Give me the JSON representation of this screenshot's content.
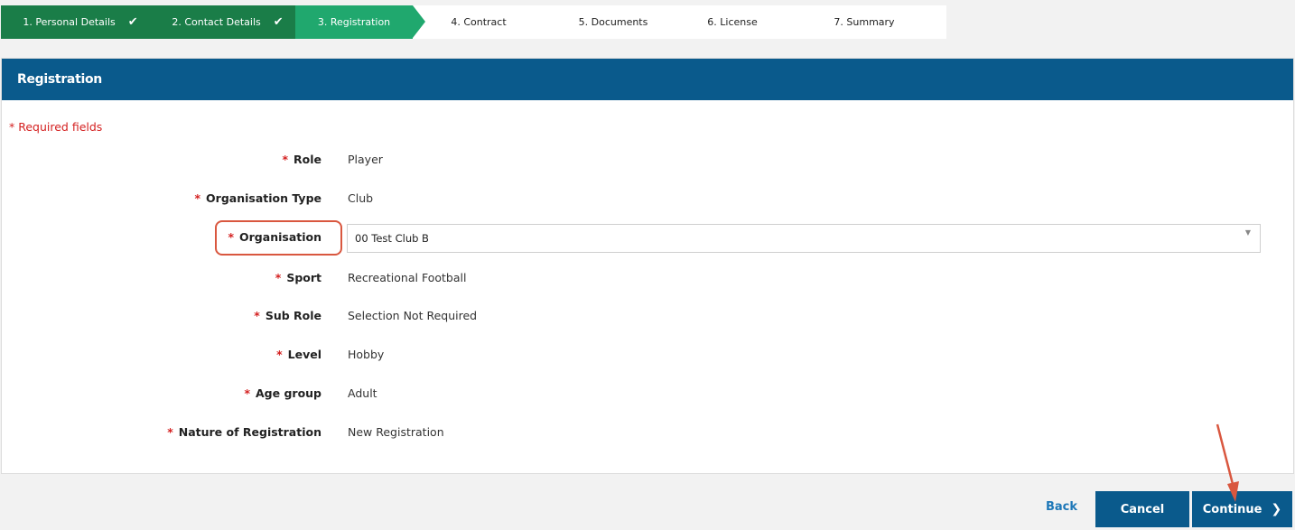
{
  "stepper": {
    "steps": [
      {
        "label": "1. Personal Details",
        "status": "done",
        "check": "✔"
      },
      {
        "label": "2. Contact Details",
        "status": "done",
        "check": "✔"
      },
      {
        "label": "3. Registration",
        "status": "active"
      },
      {
        "label": "4. Contract",
        "status": "pending"
      },
      {
        "label": "5. Documents",
        "status": "pending"
      },
      {
        "label": "6. License",
        "status": "pending"
      },
      {
        "label": "7. Summary",
        "status": "pending"
      }
    ]
  },
  "panel": {
    "title": "Registration",
    "required_note": "* Required fields"
  },
  "form": {
    "fields": [
      {
        "label": "Role",
        "value": "Player"
      },
      {
        "label": "Organisation Type",
        "value": "Club"
      },
      {
        "label": "Organisation",
        "value": "00 Test Club B"
      },
      {
        "label": "Sport",
        "value": "Recreational Football"
      },
      {
        "label": "Sub Role",
        "value": "Selection Not Required"
      },
      {
        "label": "Level",
        "value": "Hobby"
      },
      {
        "label": "Age group",
        "value": "Adult"
      },
      {
        "label": "Nature of Registration",
        "value": "New Registration"
      }
    ],
    "star": "*",
    "select_caret": "▼"
  },
  "footer": {
    "back_label": "Back",
    "cancel_label": "Cancel",
    "continue_label": "Continue",
    "continue_chevron": "❯"
  },
  "colors": {
    "header_blue": "#0a5a8c",
    "step_done_green": "#1a7d48",
    "step_active_green": "#20a86e",
    "required_red": "#d42020",
    "annotation_red": "#d9573f",
    "link_blue": "#1e78b8"
  }
}
